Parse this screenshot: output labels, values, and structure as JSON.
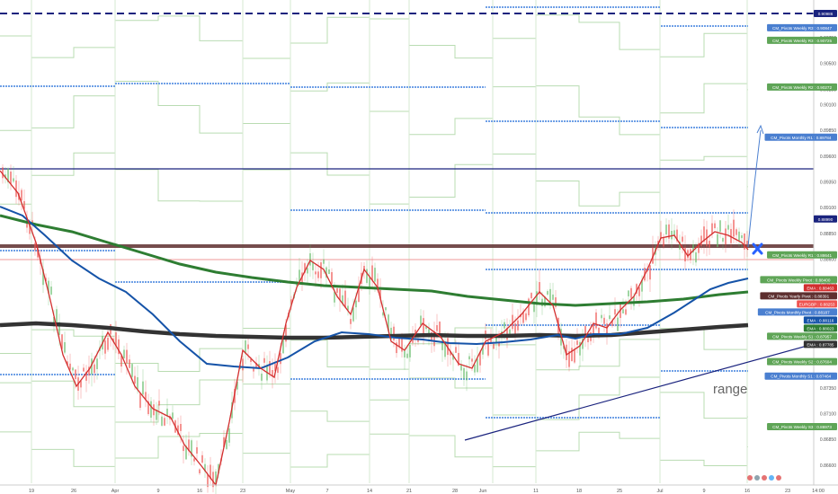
{
  "chart_data": {
    "type": "candlestick",
    "price_axis": {
      "range": [
        0.866,
        0.9095
      ],
      "ticks": [
        "0.90750",
        "0.90500",
        "0.90250",
        "0.90100",
        "0.89850",
        "0.89600",
        "0.89350",
        "0.89100",
        "0.88850",
        "0.88600",
        "0.88350",
        "0.88100",
        "0.87850",
        "0.87600",
        "0.87350",
        "0.87100",
        "0.86850",
        "0.86600",
        "0.86350"
      ]
    },
    "time_axis": {
      "labels": [
        "19",
        "26",
        "Apr",
        "9",
        "16",
        "23",
        "May",
        "7",
        "14",
        "21",
        "28",
        "Jun",
        "11",
        "18",
        "25",
        "Jul",
        "9",
        "16",
        "23",
        "14:00"
      ]
    },
    "price_labels": [
      {
        "text": "0.90986",
        "value": 0.90986,
        "color": "#ffffff",
        "bg": "#1a237e"
      },
      {
        "text": "CM_Pivots Weekly R3 : 0.90847",
        "value": 0.90847,
        "color": "#ffffff",
        "bg": "#4a7fd0"
      },
      {
        "text": "CM_Pivots Weekly R3 : 0.90725",
        "value": 0.90725,
        "color": "#ffffff",
        "bg": "#5fa557"
      },
      {
        "text": "CM_Pivots Weekly R2 : 0.90272",
        "value": 0.90272,
        "color": "#ffffff",
        "bg": "#5fa557"
      },
      {
        "text": "CM_Pivots Monthly R1 : 0.89784",
        "value": 0.89784,
        "color": "#ffffff",
        "bg": "#4a7fd0"
      },
      {
        "text": "0.88990",
        "value": 0.8899,
        "color": "#ffffff",
        "bg": "#1a237e"
      },
      {
        "text": "CM_Pivots Weekly R1 : 0.88641",
        "value": 0.88641,
        "color": "#ffffff",
        "bg": "#5fa557"
      },
      {
        "text": "CM_Pivots Weekly Pivot : 0.88400",
        "value": 0.884,
        "color": "#ffffff",
        "bg": "#5fa557"
      },
      {
        "text": "EMA : 0.88463",
        "value": 0.88463,
        "color": "#ffffff",
        "bg": "#d32f2f"
      },
      {
        "text": "CM_Pivots Yearly Pivot : 0.88391",
        "value": 0.88391,
        "color": "#ffffff",
        "bg": "#5d2f2f"
      },
      {
        "text": "EURGBP : 0.88253",
        "value": 0.88253,
        "color": "#ffffff",
        "bg": "#ef5350"
      },
      {
        "text": "CM_Pivots Monthly Pivot : 0.88187",
        "value": 0.88187,
        "color": "#ffffff",
        "bg": "#4a7fd0"
      },
      {
        "text": "EMA : 0.88116",
        "value": 0.88116,
        "color": "#ffffff",
        "bg": "#1553a8"
      },
      {
        "text": "EMA : 0.88023",
        "value": 0.88023,
        "color": "#ffffff",
        "bg": "#2e7d32"
      },
      {
        "text": "CM_Pivots Weekly S1 : 0.87957",
        "value": 0.87957,
        "color": "#ffffff",
        "bg": "#5fa557"
      },
      {
        "text": "EMA : 0.87785",
        "value": 0.87785,
        "color": "#ffffff",
        "bg": "#333333"
      },
      {
        "text": "CM_Pivots Weekly S2 : 0.87604",
        "value": 0.87604,
        "color": "#ffffff",
        "bg": "#5fa557"
      },
      {
        "text": "CM_Pivots Monthly S1 : 0.87464",
        "value": 0.87464,
        "color": "#ffffff",
        "bg": "#4a7fd0"
      },
      {
        "text": "CM_Pivots Weekly S3 : 0.86973",
        "value": 0.86973,
        "color": "#ffffff",
        "bg": "#5fa557"
      }
    ],
    "annotations": [
      {
        "text": "range",
        "type": "label"
      }
    ],
    "series": [
      {
        "type": "ema",
        "period_hint": "fast",
        "color": "#d32f2f",
        "last": 0.88463
      },
      {
        "type": "ema",
        "period_hint": "mid",
        "color": "#1553a8",
        "last": 0.88116
      },
      {
        "type": "ema",
        "period_hint": "slow",
        "color": "#2e7d32",
        "last": 0.88023
      },
      {
        "type": "ema",
        "period_hint": "longest",
        "color": "#333333",
        "last": 0.87785
      }
    ],
    "grid": false,
    "legend": "none",
    "last_price": 0.88253
  }
}
